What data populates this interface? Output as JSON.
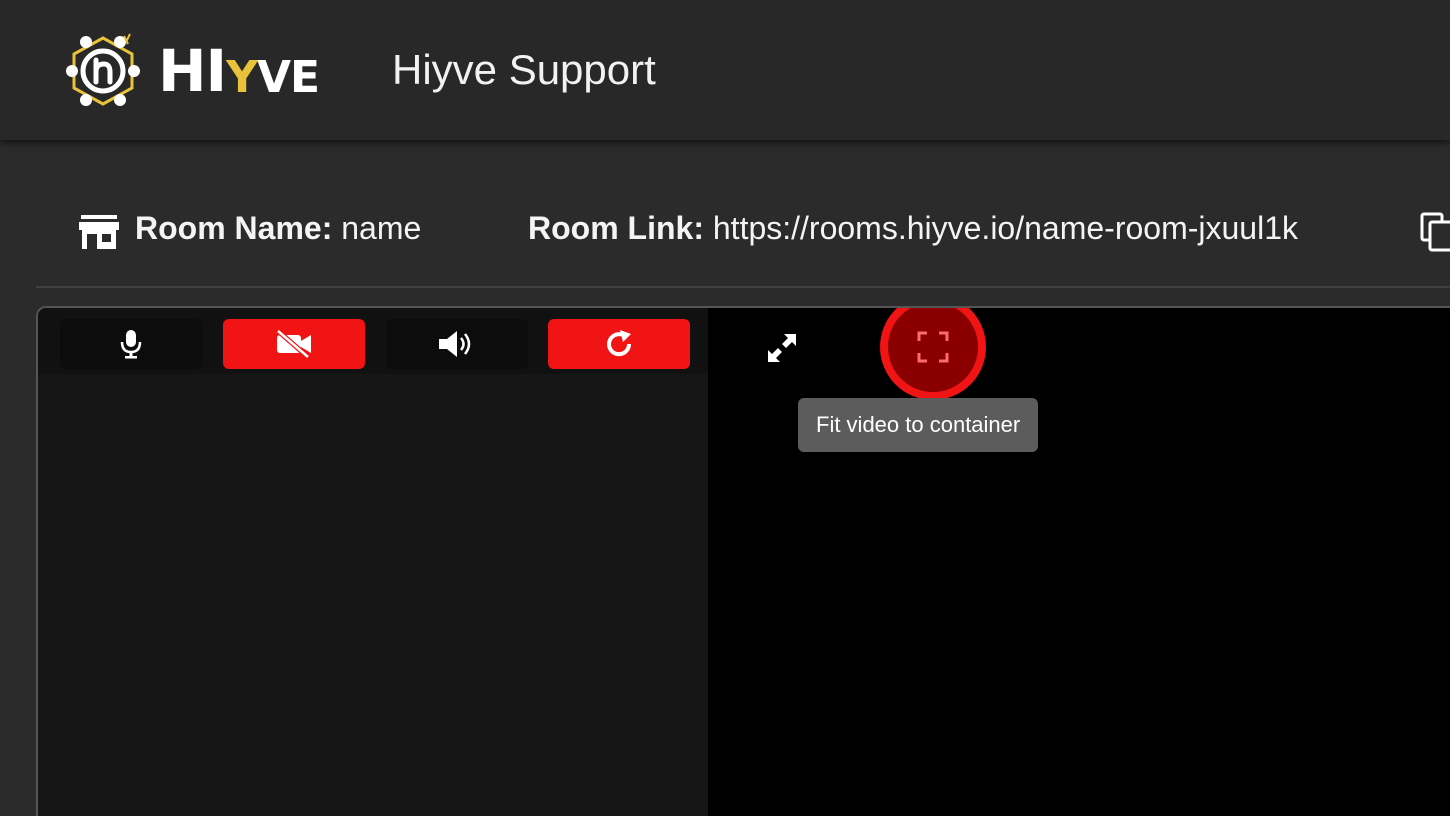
{
  "header": {
    "logo_text": "HIYVE",
    "logo_text_part1": "HI",
    "logo_text_part2": "Y",
    "logo_text_part3": "VE",
    "app_title": "Hiyve Support"
  },
  "room": {
    "icon": "storefront-icon",
    "name_label": "Room Name:",
    "name_value": "name",
    "link_label": "Room Link:",
    "link_value": "https://rooms.hiyve.io/name-room-jxuul1k",
    "copy_icon": "copy-icon"
  },
  "controls": [
    {
      "name": "microphone",
      "icon": "microphone-icon",
      "state": "on"
    },
    {
      "name": "camera",
      "icon": "camera-off-icon",
      "state": "off"
    },
    {
      "name": "speaker",
      "icon": "volume-up-icon",
      "state": "on"
    },
    {
      "name": "refresh",
      "icon": "refresh-icon",
      "state": "active"
    }
  ],
  "remote_controls": [
    {
      "name": "expand",
      "icon": "expand-arrows-icon"
    },
    {
      "name": "fit-video",
      "icon": "fit-to-container-icon",
      "highlighted": true
    }
  ],
  "tooltip": {
    "text": "Fit video to container"
  },
  "colors": {
    "accent_red": "#f01414",
    "highlight_fill": "#8a0000",
    "logo_gold": "#e7c23a",
    "background": "#2b2b2b",
    "tooltip_bg": "#5c5c5c"
  }
}
